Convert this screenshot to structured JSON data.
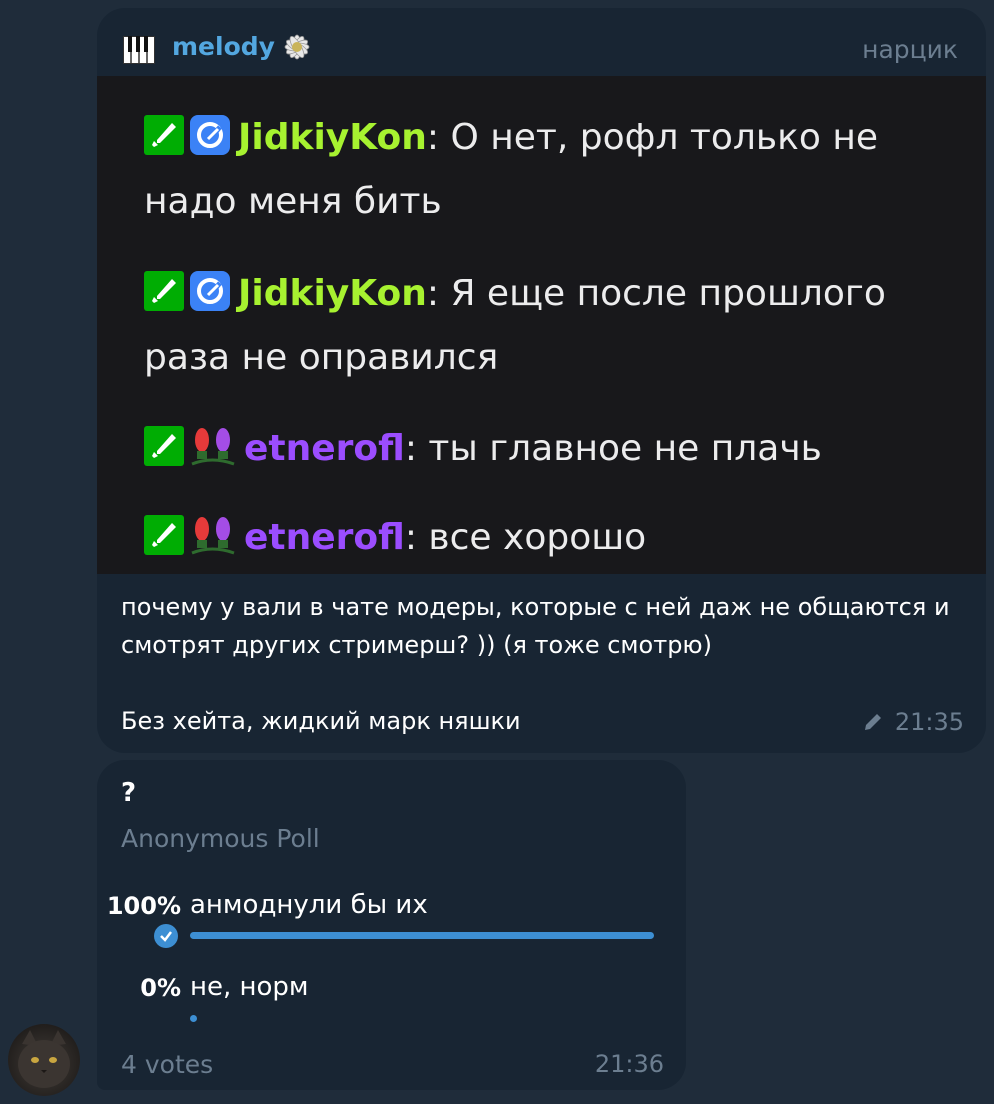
{
  "message1": {
    "sender_name": "melody",
    "author_signature": "нарцик",
    "screenshot_chat": [
      {
        "username": "JidkiyKon",
        "text": ": О нет, рофл только не надо меня бить"
      },
      {
        "username": "JidkiyKon",
        "text": ": Я еще после прошлого раза не оправился"
      },
      {
        "username": "etnerofl",
        "text": ": ты главное не плачь"
      },
      {
        "username": "etnerofl",
        "text": ": все хорошо"
      }
    ],
    "caption_line1": "почему у вали в чате модеры, которые с ней даж не общаются и смотрят других стримерш? )) (я тоже смотрю)",
    "caption_line2": "Без хейта, жидкий марк няшки",
    "time": "21:35",
    "edited_icon": "pencil-icon"
  },
  "poll": {
    "question": "?",
    "type_label": "Anonymous Poll",
    "options": [
      {
        "percent_label": "100%",
        "text": "анмоднули бы их",
        "fraction": 1.0,
        "chosen": true
      },
      {
        "percent_label": "0%",
        "text": "не,  норм",
        "fraction": 0.0,
        "chosen": false
      }
    ],
    "votes_label": "4 votes",
    "time": "21:36"
  },
  "colors": {
    "background": "#1f2c3a",
    "bubble": "#182533",
    "accent": "#53a7e0",
    "muted": "#6c7e90",
    "twitch_green_name": "#a7f230",
    "twitch_purple_name": "#9b4dff",
    "poll_bar": "#3d8fd3"
  }
}
